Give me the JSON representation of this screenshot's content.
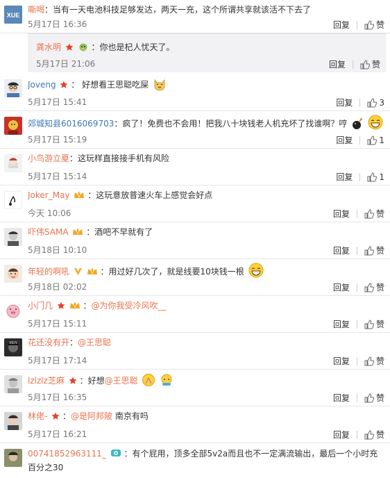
{
  "comments": [
    {
      "username": "嘶喝",
      "text": "：当有一天电池科技足够发达，两天一充，这个所谓共享就该活不下去了",
      "time": "5月17日 16:36",
      "reply_label": "回复",
      "like_label": "赞",
      "avatar_text": "XUE",
      "avatar_color": "#5a88b8"
    },
    {
      "username": "龚水明",
      "text": "：你也是杞人忧天了。",
      "time": "5月17日 21:06",
      "reply_label": "回复",
      "like_label": "赞"
    },
    {
      "username": "Joveng",
      "text": "： 好想看王思聪吃屎",
      "time": "5月17日 15:41",
      "reply_label": "回复",
      "like_count": "3"
    },
    {
      "username": "郊城知县6016069703",
      "text": "：疯了！免费也不会用！把我八十块钱老人机充坏了找谁啊？哼",
      "time": "5月17日 15:19",
      "reply_label": "回复",
      "like_count": "1"
    },
    {
      "username": "小鸟游立夏",
      "text": "：这玩样直接接手机有风险",
      "time": "5月17日 15:14",
      "reply_label": "回复",
      "like_count": "1"
    },
    {
      "username": "Joker_May",
      "text": "：这玩意放普速火车上感觉会好点",
      "time": "今天 10:06",
      "reply_label": "回复",
      "like_label": "赞"
    },
    {
      "username": "吓伟SAMA",
      "text": "：酒吧不早就有了",
      "time": "5月18日 10:10",
      "reply_label": "回复",
      "like_label": "赞"
    },
    {
      "username": "年轻的啊吼",
      "text": "：用过好几次了，就是线要10块钱一根",
      "time": "5月18日 02:02",
      "reply_label": "回复",
      "like_label": "赞"
    },
    {
      "username": "小门几",
      "mention": "@为你我受冷风吹__",
      "text": "：",
      "time": "5月17日 15:11",
      "reply_label": "回复",
      "like_label": "赞"
    },
    {
      "username": "花还没有开",
      "mention": "@王思聪",
      "text": "：",
      "time": "5月17日 17:14",
      "reply_label": "回复",
      "like_label": "赞"
    },
    {
      "username": "lzlzlz芝麻",
      "mention": "@王思聪",
      "text": "：好想",
      "time": "5月17日 16:35",
      "reply_label": "回复",
      "like_label": "赞"
    },
    {
      "username": "林佬-",
      "mention": "@是阿邦陂",
      "text": "：",
      "after": " 南京有吗",
      "time": "5月17日 16:21",
      "reply_label": "回复",
      "like_label": "赞"
    },
    {
      "username": "00741852963111_",
      "text": "：有个屁用，顶多全部5v2a而且也不一定满流输出，最后一个小时充百分之30"
    }
  ],
  "colors": {
    "username": "#eb7350",
    "badge_red": "#e8412b",
    "badge_gold": "#f5a623"
  },
  "icons": [
    "thumb-up-icon",
    "vip-badge-icon",
    "crown-badge-icon",
    "laugh-emoji-icon",
    "bomb-emoji-icon"
  ]
}
